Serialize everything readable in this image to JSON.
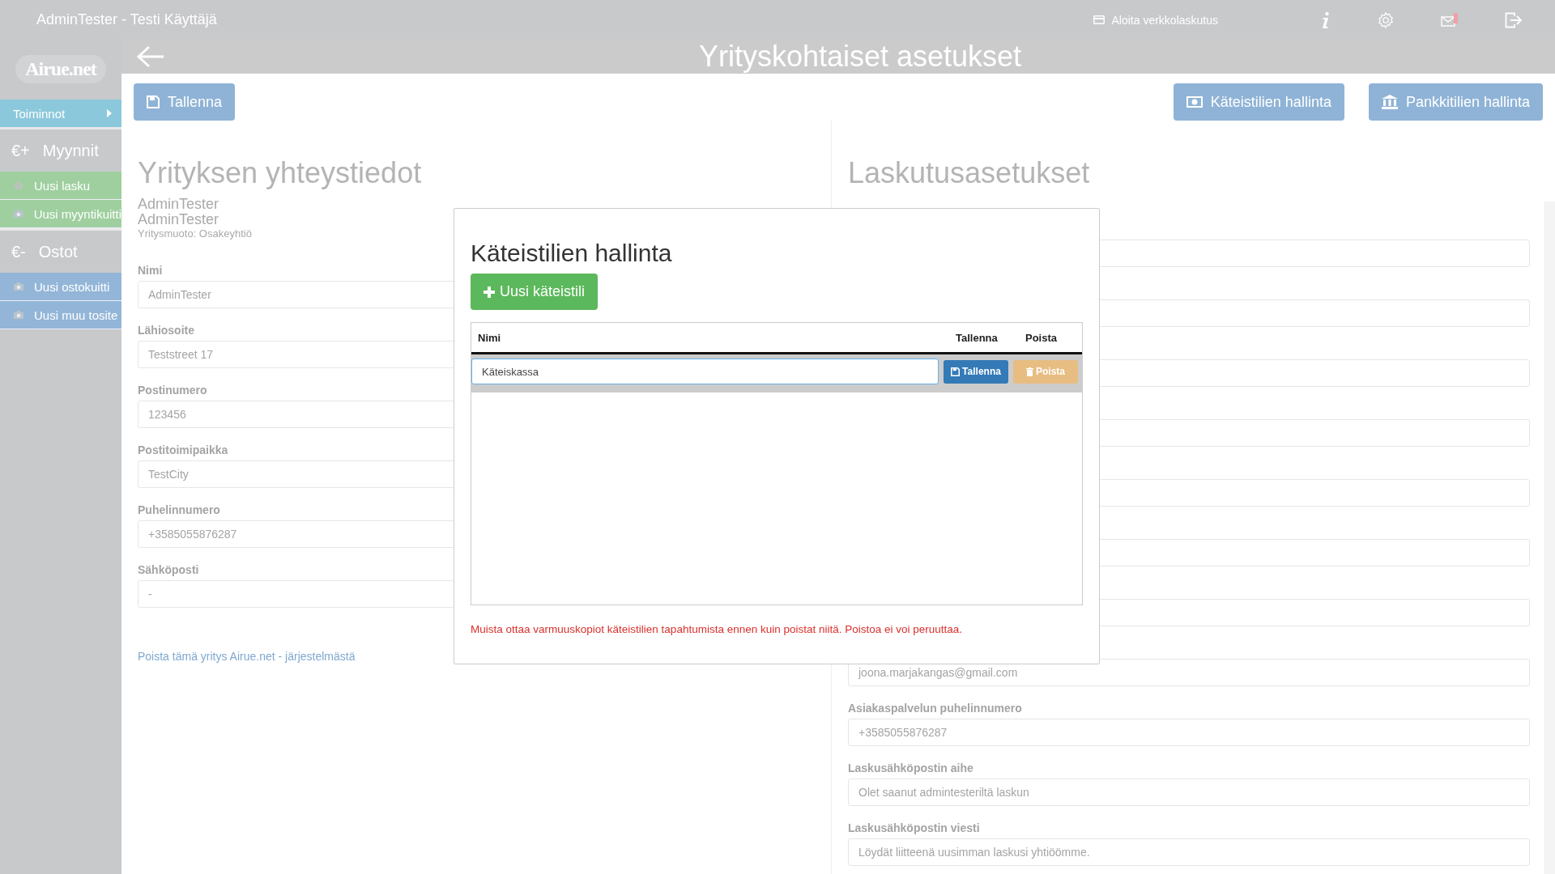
{
  "topbar": {
    "user": "AdminTester - Testi Käyttäjä",
    "einvoice_link": "Aloita verkkolaskutus",
    "mail_alert": true
  },
  "logo": "Airue.net",
  "sidebar": {
    "menu_toggle": "Toiminnot",
    "sections": [
      {
        "symbol": "€+",
        "title": "Myynnit",
        "color": "#9fcf9f",
        "items": [
          {
            "kind": "piggy",
            "label": "Uusi lasku"
          },
          {
            "kind": "camera",
            "label": "Uusi myyntikuitti"
          }
        ]
      },
      {
        "symbol": "€-",
        "title": "Ostot",
        "color": "#93b6d8",
        "items": [
          {
            "kind": "camera",
            "label": "Uusi ostokuitti"
          },
          {
            "kind": "camera",
            "label": "Uusi muu tosite"
          }
        ]
      }
    ]
  },
  "header": {
    "title": "Yrityskohtaiset asetukset"
  },
  "toolbar": {
    "save": "Tallenna",
    "cash_accounts": "Käteistilien hallinta",
    "bank_accounts": "Pankkitilien hallinta"
  },
  "company": {
    "title": "Yrityksen yhteystiedot",
    "lines": [
      "AdminTester",
      "AdminTester"
    ],
    "company_form": "Yritysmuoto: Osakeyhtiö",
    "fields": [
      {
        "label": "Nimi",
        "value": "AdminTester"
      },
      {
        "label": "Lähiosoite",
        "value": "Teststreet 17"
      },
      {
        "label": "Postinumero",
        "value": "123456"
      },
      {
        "label": "Postitoimipaikka",
        "value": "TestCity"
      },
      {
        "label": "Puhelinnumero",
        "value": "+3585055876287"
      },
      {
        "label": "Sähköposti",
        "value": "-"
      }
    ],
    "delete_link": "Poista tämä yritys Airue.net - järjestelmästä"
  },
  "billing": {
    "title": "Laskutusasetukset",
    "fields": [
      {
        "kind": "empty"
      },
      {
        "kind": "empty"
      },
      {
        "kind": "empty"
      },
      {
        "kind": "empty"
      },
      {
        "kind": "empty"
      },
      {
        "kind": "empty"
      },
      {
        "kind": "empty"
      },
      {
        "kind": "value",
        "value": "joona.marjakangas@gmail.com"
      },
      {
        "kind": "labeled",
        "label": "Asiakaspalvelun puhelinnumero",
        "value": "+3585055876287"
      },
      {
        "kind": "labeled",
        "label": "Laskusähköpostin aihe",
        "value": "Olet saanut admintesteriltä laskun"
      },
      {
        "kind": "labeled",
        "label": "Laskusähköpostin viesti",
        "value": "Löydät liitteenä uusimman laskusi yhtiöömme."
      }
    ]
  },
  "modal": {
    "title": "Käteistilien hallinta",
    "new_button": "Uusi käteistili",
    "columns": [
      "Nimi",
      "Tallenna",
      "Poista"
    ],
    "rows": [
      {
        "name": "Käteiskassa",
        "save": "Tallenna",
        "delete": "Poista",
        "delete_disabled": true
      }
    ],
    "warning": "Muista ottaa varmuuskopiot käteistilien tapahtumista ennen kuin poistat niitä. Poistoa ei voi peruuttaa."
  }
}
